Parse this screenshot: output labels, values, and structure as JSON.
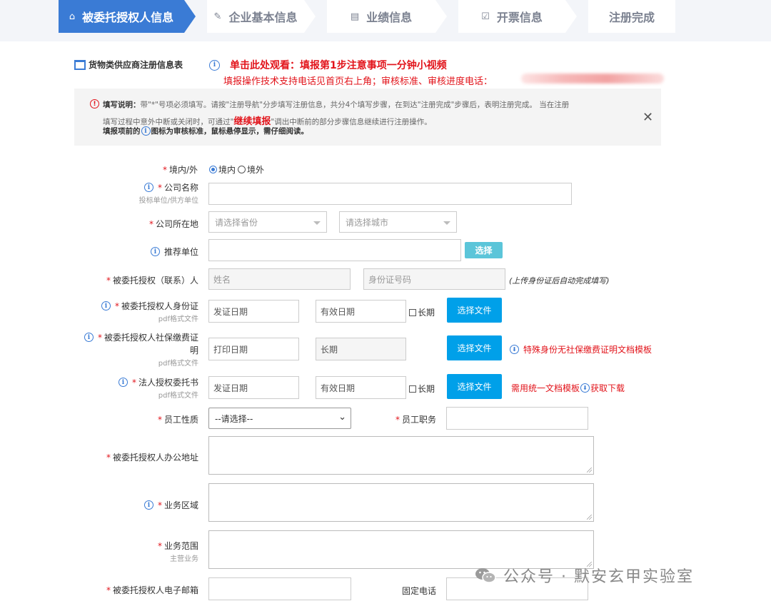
{
  "steps": [
    {
      "label": "被委托授权人信息",
      "icon": "lock-icon",
      "glyph": "⌂",
      "active": true
    },
    {
      "label": "企业基本信息",
      "icon": "edit-icon",
      "glyph": "✎",
      "active": false
    },
    {
      "label": "业绩信息",
      "icon": "card-icon",
      "glyph": "▤",
      "active": false
    },
    {
      "label": "开票信息",
      "icon": "check-icon",
      "glyph": "☑",
      "active": false
    },
    {
      "label": "注册完成",
      "icon": "",
      "glyph": "",
      "active": false
    }
  ],
  "header": {
    "form_title": "货物类供应商注册信息表",
    "video_link": "单击此处观看：填报第1步注意事项一分钟小视频",
    "support_text": "填报操作技术支持电话见首页右上角；审核标准、审核进度电话："
  },
  "notice": {
    "line1_bold": "填写说明：",
    "line1": "带\"*\"号项必须填写。请按\"注册导航\"分步填写注册信息，共分4个填写步骤，在到达\"注册完成\"步骤后，表明注册完成。 当在注册",
    "line2a": "填写过程中意外中断或关闭时，可通过\"",
    "line2_link": "继续填报",
    "line2b": "\"调出中断前的部分步骤信息继续进行注册操作。",
    "line3a": "填报项前的",
    "line3b": "图标为审核标准，鼠标悬停显示，需仔细阅读。"
  },
  "form": {
    "domestic_label": "境内/外",
    "domestic_opt1": "境内",
    "domestic_opt2": "境外",
    "company_name_label": "公司名称",
    "company_name_sub": "投标单位/供方单位",
    "location_label": "公司所在地",
    "province_placeholder": "请选择省份",
    "city_placeholder": "请选择城市",
    "recommender_label": "推荐单位",
    "select_btn": "选择",
    "contact_label": "被委托授权（联系）人",
    "name_placeholder": "姓名",
    "id_placeholder": "身份证号码",
    "contact_hint": "(上传身份证后自动完成填写)",
    "id_card_label": "被委托授权人身份证",
    "pdf_sub": "pdf格式文件",
    "issue_date": "发证日期",
    "valid_date": "有效日期",
    "long_term": "长期",
    "choose_file": "选择文件",
    "social_label_1": "被委托授权人社保缴费证",
    "social_label_2": "明",
    "print_date": "打印日期",
    "social_long": "长期",
    "social_note": "特殊身份无社保缴费证明文档模板",
    "auth_label": "法人授权委托书",
    "auth_note_a": "需用统一文档模板",
    "auth_note_b": "获取下载",
    "staff_type_label": "员工性质",
    "staff_type_value": "--请选择--",
    "staff_title_label": "员工职务",
    "office_addr_label": "被委托授权人办公地址",
    "biz_area_label": "业务区域",
    "biz_scope_label": "业务范围",
    "biz_scope_sub": "主营业务",
    "email_label": "被委托授权人电子邮箱",
    "phone_label": "固定电话"
  },
  "watermark": "公众号 · 默安玄甲实验室",
  "colors": {
    "accent": "#3a7bd5",
    "button": "#00a0e9",
    "warning": "#e2141b"
  }
}
